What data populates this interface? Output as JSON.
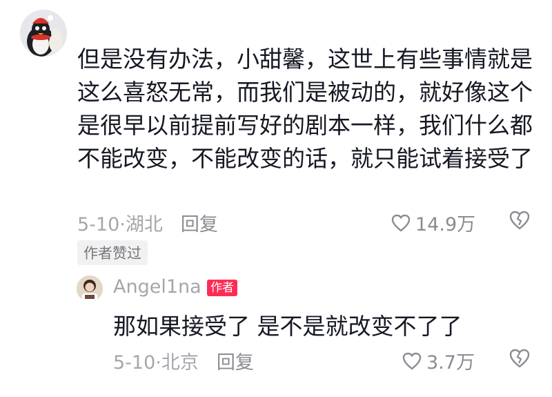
{
  "comment": {
    "text": "但是没有办法，小甜馨，这世上有些事情就是这么喜怒无常，而我们是被动的，就好像这个是很早以前提前写好的剧本一样，我们什么都不能改变，不能改变的话，就只能试着接受了",
    "date_location": "5-10·湖北",
    "reply_label": "回复",
    "likes": "14.9万",
    "author_liked_badge": "作者赞过",
    "avatar_icon": "penguin-avatar-icon"
  },
  "reply": {
    "username": "Angel1na",
    "author_tag": "作者",
    "text": "那如果接受了 是不是就改变不了了",
    "date_location": "5-10·北京",
    "reply_label": "回复",
    "likes": "3.7万",
    "avatar_icon": "girl-avatar-icon"
  },
  "colors": {
    "accent": "#fe2c55",
    "meta": "#a4a6ab",
    "text": "#161823"
  }
}
